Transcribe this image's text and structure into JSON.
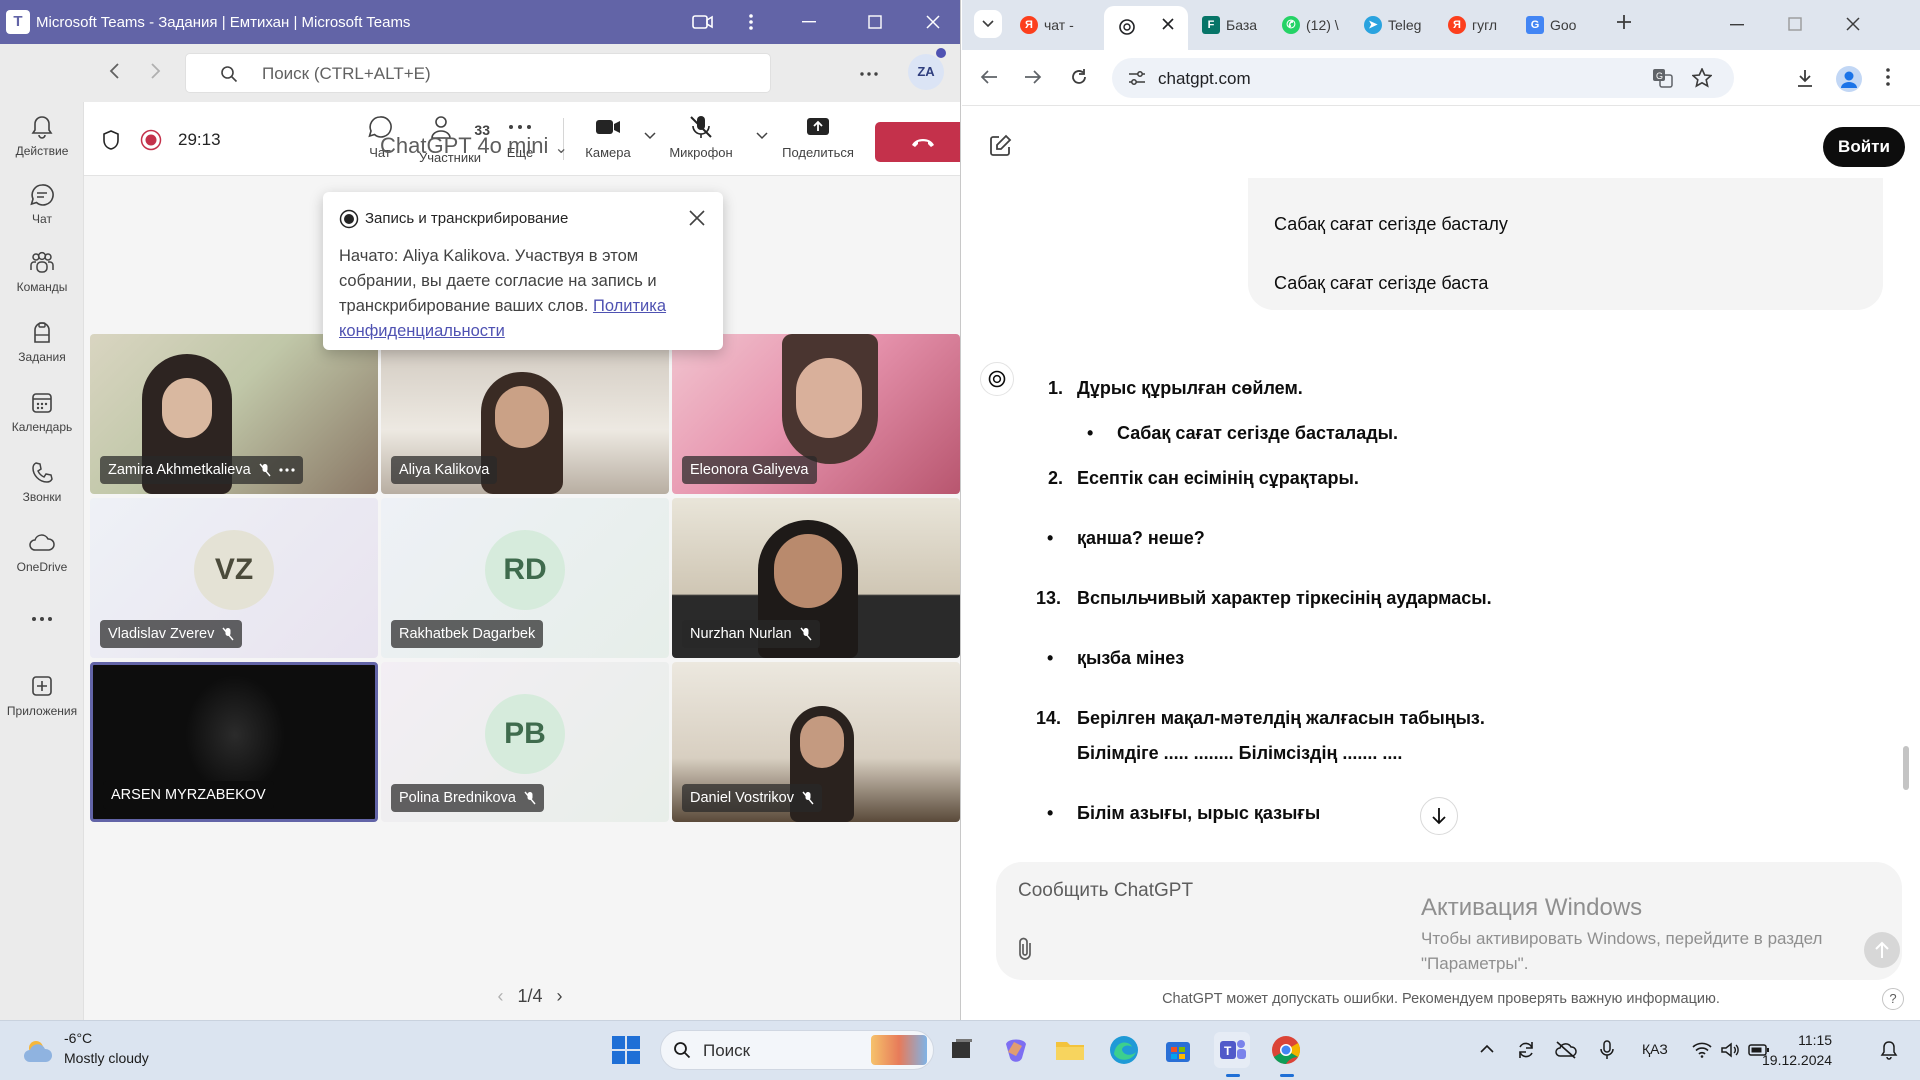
{
  "teams": {
    "window_title": "Microsoft Teams - Задания | Емтихан | Microsoft Teams",
    "search_placeholder": "Поиск (CTRL+ALT+E)",
    "avatar_initials": "ZA",
    "rail": [
      {
        "label": "Действие",
        "icon": "bell-icon"
      },
      {
        "label": "Чат",
        "icon": "chat-icon"
      },
      {
        "label": "Команды",
        "icon": "teams-icon"
      },
      {
        "label": "Задания",
        "icon": "assignments-icon"
      },
      {
        "label": "Календарь",
        "icon": "calendar-icon"
      },
      {
        "label": "Звонки",
        "icon": "phone-icon"
      },
      {
        "label": "OneDrive",
        "icon": "cloud-icon"
      },
      {
        "label": "Приложения",
        "icon": "add-apps-icon"
      }
    ],
    "meeting": {
      "timer": "29:13",
      "chat_label": "Чат",
      "participants_label": "Участники",
      "participants_count": "33",
      "more_label": "Еще",
      "camera_label": "Камера",
      "mic_label": "Микрофон",
      "share_label": "Поделиться"
    },
    "recording_popup": {
      "title": "Запись и транскрибирование",
      "body": "Начато: Aliya Kalikova. Участвуя в этом собрании, вы даете согласие на запись и транскрибирование ваших слов.",
      "link": "Политика конфиденциальности"
    },
    "participants": [
      {
        "name": "Zamira Akhmetkalieva",
        "type": "video",
        "muted": true,
        "more": true
      },
      {
        "name": "Aliya Kalikova",
        "type": "video",
        "muted": false
      },
      {
        "name": "Eleonora Galiyeva",
        "type": "video",
        "muted": false
      },
      {
        "name": "Vladislav Zverev",
        "type": "initials",
        "initials": "VZ",
        "muted": true
      },
      {
        "name": "Rakhatbek Dagarbek",
        "type": "initials",
        "initials": "RD",
        "muted": false
      },
      {
        "name": "Nurzhan Nurlan",
        "type": "video",
        "muted": true
      },
      {
        "name": "ARSEN MYRZABEKOV",
        "type": "video",
        "muted": false,
        "selected": true
      },
      {
        "name": "Polina Brednikova",
        "type": "initials",
        "initials": "PB",
        "muted": true
      },
      {
        "name": "Daniel Vostrikov",
        "type": "video",
        "muted": true
      }
    ],
    "pager": "1/4"
  },
  "chrome": {
    "tabs": [
      {
        "label": "чат -",
        "icon": "yandex-icon"
      },
      {
        "label": "",
        "icon": "chatgpt-icon",
        "active": true
      },
      {
        "label": "База",
        "icon": "forms-icon"
      },
      {
        "label": "(12) \\",
        "icon": "whatsapp-icon"
      },
      {
        "label": "Teleg",
        "icon": "telegram-icon"
      },
      {
        "label": "гугл",
        "icon": "yandex-icon"
      },
      {
        "label": "Goo",
        "icon": "google-icon"
      }
    ],
    "url": "chatgpt.com"
  },
  "chatgpt": {
    "model": "ChatGPT 4o mini",
    "login": "Войти",
    "user_lines": [
      "Сабақ сағат сегізде басталу",
      "Сабақ сағат сегізде баста"
    ],
    "answer": [
      {
        "marker": "1.",
        "text": "Дұрыс құрылған сөйлем."
      },
      {
        "marker": "•",
        "text": "Сабақ сағат сегізде басталады."
      },
      {
        "marker": "2.",
        "text": "Есептік сан есімінің сұрақтары."
      },
      {
        "marker": "•",
        "text": "қанша? неше?"
      },
      {
        "marker": "13.",
        "text": "Вспыльчивый характер тіркесінің аудармасы."
      },
      {
        "marker": "•",
        "text": "қызба мінез"
      },
      {
        "marker": "14.",
        "text": "Берілген мақал-мәтелдің жалғасын табыңыз."
      },
      {
        "marker": "",
        "text": "Білімдіге ..... ........ Білімсіздің ....... ...."
      },
      {
        "marker": "•",
        "text": "Білім азығы, ырыс қазығы"
      }
    ],
    "composer_placeholder": "Сообщить ChatGPT",
    "disclaimer": "ChatGPT может допускать ошибки. Рекомендуем проверять важную информацию."
  },
  "watermark": {
    "title": "Активация Windows",
    "body": "Чтобы активировать Windows, перейдите в раздел \"Параметры\"."
  },
  "taskbar": {
    "temperature": "-6°C",
    "condition": "Mostly cloudy",
    "search": "Поиск",
    "language": "ҚАЗ",
    "time": "11:15",
    "date": "19.12.2024"
  },
  "colors": {
    "teams_purple": "#6264a7",
    "hangup_red": "#c4314b",
    "link": "#4f52b2"
  }
}
